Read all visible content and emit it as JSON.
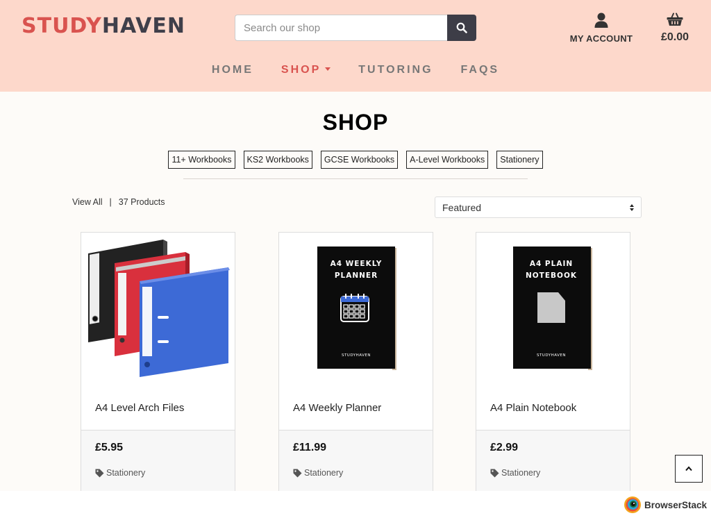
{
  "header": {
    "logo_part1": "STUDY",
    "logo_part2": "HAVEN",
    "search_placeholder": "Search our shop",
    "account_label": "MY ACCOUNT",
    "cart_total": "£0.00"
  },
  "nav": {
    "items": [
      {
        "label": "HOME"
      },
      {
        "label": "SHOP"
      },
      {
        "label": "TUTORING"
      },
      {
        "label": "FAQS"
      }
    ]
  },
  "main": {
    "title": "SHOP",
    "categories": [
      "11+ Workbooks",
      "KS2 Workbooks",
      "GCSE Workbooks",
      "A-Level Workbooks",
      "Stationery"
    ],
    "view_all": "View All",
    "product_count": "37 Products",
    "sort_value": "Featured"
  },
  "products": [
    {
      "name": "A4 Level Arch Files",
      "price": "£5.95",
      "category": "Stationery"
    },
    {
      "name": "A4 Weekly Planner",
      "price": "£11.99",
      "category": "Stationery",
      "cover_line1": "A4 WEEKLY",
      "cover_line2": "PLANNER",
      "cover_brand": "STUDYHAVEN"
    },
    {
      "name": "A4 Plain Notebook",
      "price": "£2.99",
      "category": "Stationery",
      "cover_line1": "A4 PLAIN",
      "cover_line2": "NOTEBOOK",
      "cover_brand": "STUDYHAVEN"
    }
  ],
  "footer": {
    "browserstack_label": "BrowserStack"
  },
  "colors": {
    "header_bg": "#fdd8cb",
    "accent": "#d9534f",
    "dark": "#3d3d47"
  }
}
